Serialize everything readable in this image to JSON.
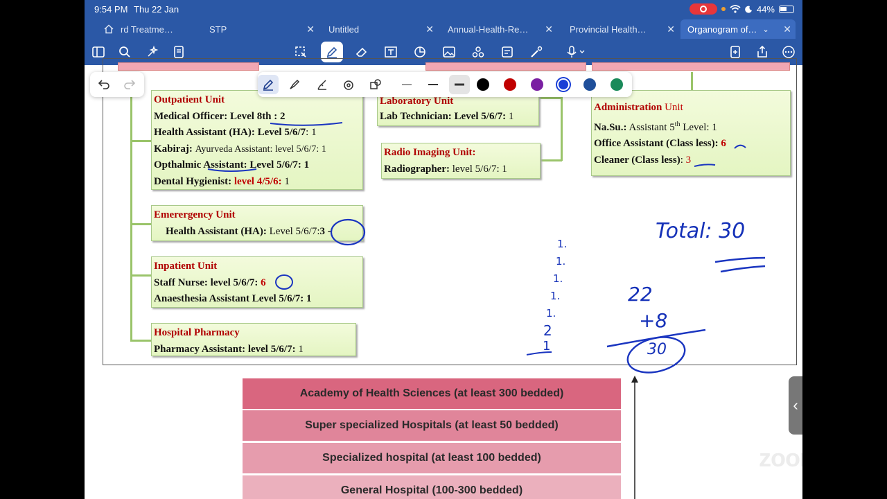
{
  "status": {
    "time": "9:54 PM",
    "date": "Thu 22 Jan",
    "battery": "44%"
  },
  "tabs": [
    {
      "label": "rd Treatme…"
    },
    {
      "label": "STP"
    },
    {
      "label": "Untitled"
    },
    {
      "label": "Annual-Health-Re…"
    },
    {
      "label": "Provincial Health…"
    },
    {
      "label": "Organogram of…"
    }
  ],
  "toolbar_icons": [
    "sidebar-icon",
    "search-icon",
    "sparkle-icon",
    "document-search-icon",
    "lasso-icon",
    "pen-icon",
    "eraser-icon",
    "text-box-icon",
    "shapes-icon",
    "image-icon",
    "stickers-icon",
    "note-icon",
    "laser-icon",
    "microphone-icon",
    "add-page-icon",
    "share-icon",
    "more-icon"
  ],
  "pen_colors": [
    "#000000",
    "#c00000",
    "#7a1fa2",
    "#1a3fd6",
    "#1f4f9a",
    "#1a8a5a"
  ],
  "org": {
    "outpatient": {
      "title": "Outpatient Unit",
      "lines": [
        {
          "label": "Medical Officer:",
          "value": "Level 8th : 2"
        },
        {
          "label": "Health Assistant (HA):",
          "value": "Level 5/6/7",
          "count": ": 1"
        },
        {
          "label": "Kabiraj:",
          "value": "Ayurveda Assistant: level 5/6/7: 1"
        },
        {
          "label": "Opthalmic Assistant:",
          "value": "Level 5/6/7: 1"
        },
        {
          "label": "Dental Hygienist:",
          "value": "level 4/5/6:",
          "count": " 1"
        }
      ]
    },
    "emergency": {
      "title": "Emerergency Unit",
      "label": "Health Assistant (HA):",
      "value": "Level 5/6/7:",
      "count": "3 -"
    },
    "inpatient": {
      "title": "Inpatient Unit",
      "line1_label": "Staff Nurse:",
      "line1_value": "level 5/6/7:",
      "line1_count": "6",
      "line2": "Anaesthesia Assistant Level 5/6/7: 1"
    },
    "pharmacy": {
      "title": "Hospital Pharmacy",
      "label": "Pharmacy Assistant:",
      "value": "level 5/6/7:",
      "count": " 1"
    },
    "laboratory": {
      "title": "Laboratory Unit",
      "label": "Lab Technician:",
      "value": "Level 5/6/7:",
      "count": " 1"
    },
    "radio": {
      "title": "Radio Imaging Unit:",
      "label": "Radiographer:",
      "value": "level 5/6/7: 1"
    },
    "administration": {
      "title_a": "Administration",
      "title_b": " Unit",
      "l1_label": "Na.Su.:",
      "l1_value": " Assistant 5",
      "l1_sup": "th",
      "l1_rest": " Level: 1",
      "l2_label": "Office Assistant (Class less):",
      "l2_count": "6",
      "l3_label": "Cleaner (Class less)",
      "l3_colon": ":",
      "l3_count": "3"
    }
  },
  "tiers": [
    {
      "label": "Academy of Health Sciences (at least 300 bedded)",
      "color": "#d9667f"
    },
    {
      "label": "Super specialized Hospitals (at least 50 bedded)",
      "color": "#e0859a"
    },
    {
      "label": "Specialized hospital (at least 100 bedded)",
      "color": "#e69cad"
    },
    {
      "label": "General Hospital (100-300 bedded)",
      "color": "#ebb0bd"
    }
  ],
  "handwriting": {
    "total": "Total: 30",
    "sum_top": "22",
    "sum_add": "+8",
    "sum_result": "30",
    "tally": [
      "1.",
      "1.",
      "1.",
      "1.",
      "1.",
      "2",
      "1"
    ]
  },
  "zoom_watermark": "zoom"
}
